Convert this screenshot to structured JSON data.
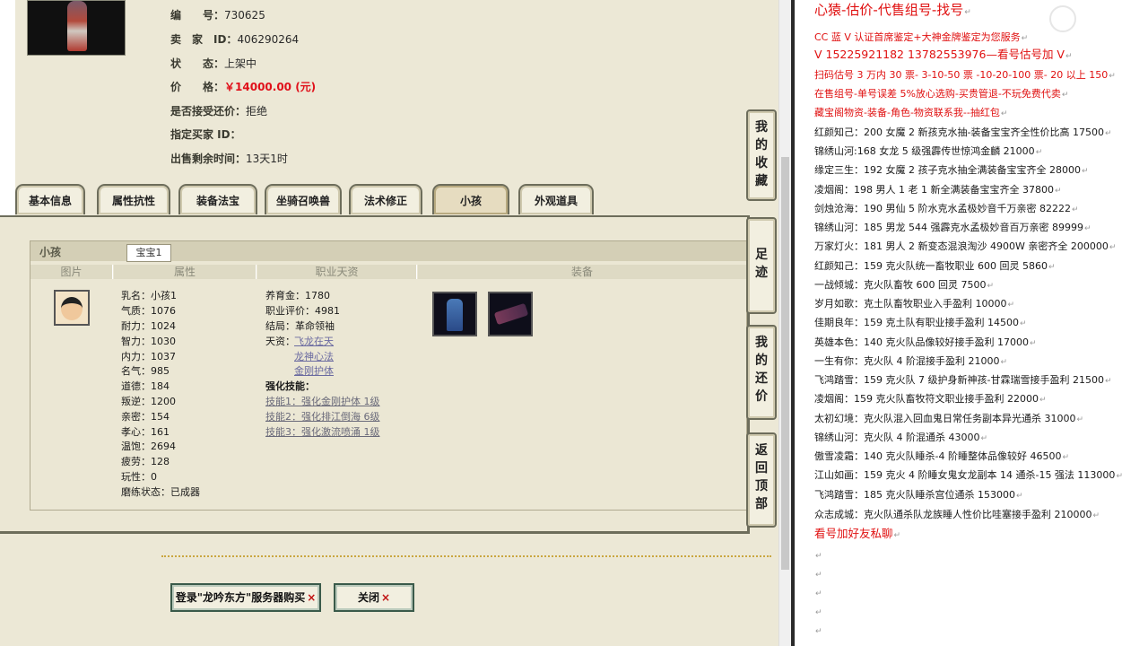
{
  "info": {
    "id_label": "编　　号：",
    "id_value": "730625",
    "seller_label": "卖　家　ID：",
    "seller_value": "406290264",
    "status_label": "状　　态：",
    "status_value": "上架中",
    "price_label": "价　　格：",
    "price_value": "￥14000.00 (元)",
    "bargain_label": "是否接受还价：",
    "bargain_value": "拒绝",
    "buyer_label": "指定买家 ID：",
    "buyer_value": "",
    "remaining_label": "出售剩余时间：",
    "remaining_value": "13天1时"
  },
  "tabs": [
    "基本信息",
    "属性抗性",
    "装备法宝",
    "坐骑召唤兽",
    "法术修正",
    "小孩",
    "外观道具"
  ],
  "child_panel": {
    "section_title": "小孩",
    "subtab": "宝宝1",
    "col_headers": [
      "图片",
      "属性",
      "职业天资",
      "装备"
    ],
    "stats": [
      "乳名：小孩1",
      "气质：1076",
      "耐力：1024",
      "智力：1030",
      "内力：1037",
      "名气：985",
      "道德：184",
      "叛逆：1200",
      "亲密：154",
      "孝心：161",
      "温饱：2694",
      "疲劳：128",
      "玩性：0",
      "磨练状态：已成器"
    ],
    "career": {
      "raise_gold": "养育金：1780",
      "eval": "职业评价：4981",
      "ending": "结局：革命领袖",
      "talent_label": "天资：",
      "talents": [
        "飞龙在天",
        "龙神心法",
        "金刚护体"
      ],
      "skills_label": "强化技能：",
      "skills": [
        "技能1：强化金刚护体 1级",
        "技能2：强化排江倒海 6级",
        "技能3：强化激流喷涌 1级"
      ]
    }
  },
  "side_buttons": [
    {
      "chars": [
        "我",
        "的",
        "收",
        "藏"
      ]
    },
    {
      "chars": [
        "足",
        "迹"
      ]
    },
    {
      "chars": [
        "我",
        "的",
        "还",
        "价"
      ]
    },
    {
      "chars": [
        "返",
        "回",
        "顶",
        "部"
      ]
    }
  ],
  "bottom_buttons": {
    "login": "登录\"龙吟东方\"服务器购买",
    "close": "关闭",
    "x": "×"
  },
  "doc": {
    "heading": "心猿-估价-代售组号-找号",
    "lines_red": [
      "CC 蓝 V 认证首席鉴定+大神金牌鉴定为您服务",
      "V 15225921182      13782553976—看号估号加 V",
      "扫码估号 3 万内 30 票- 3-10-50 票  -10-20-100 票- 20 以上 150",
      "在售组号-单号误差 5%放心选购-买贵管退-不玩免费代卖",
      "藏宝阁物资-装备-角色-物资联系我--抽红包"
    ],
    "listings": [
      "红颜知己：200 女魔 2 新孩克水抽-装备宝宝齐全性价比高 17500",
      "锦绣山河:168 女龙 5 级强霹传世惊鸿金麟 21000",
      "缘定三生：192 女魔 2 孩子克水抽全满装备宝宝齐全 28000",
      "凌烟阁：198 男人 1 老 1 新全满装备宝宝齐全 37800",
      "剑烛沧海：190 男仙 5 阶水克水孟极妙音千万亲密 82222",
      "锦绣山河：185 男龙 544 强霹克水孟极妙音百万亲密 89999",
      "万家灯火：181 男人 2 新变态混浪淘沙 4900W 亲密齐全 200000",
      "红颜知己：159 克火队统一畜牧职业 600 回灵 5860",
      "一战倾城：克火队畜牧 600 回灵 7500",
      "岁月如歌：克土队畜牧职业入手盈利 10000",
      "佳期良年：159 克土队有职业接手盈利 14500",
      "英雄本色：140 克火队品像较好接手盈利 17000",
      "一生有你：克火队 4 阶混接手盈利 21000",
      "飞鸿踏雪：159 克火队 7 级护身新神孩-甘霖瑞雪接手盈利 21500",
      "凌烟阁：159 克火队畜牧符文职业接手盈利 22000",
      "太初幻境：克火队混入回血鬼日常任务副本异光通杀 31000",
      "锦绣山河：克火队 4 阶混通杀 43000",
      "傲雪凌霜：140 克火队睡杀-4 阶睡整体品像较好 46500",
      "江山如画：159 克火 4 阶睡女鬼女龙副本 14 通杀-15 强法 113000",
      "飞鸿踏雪：185 克火队睡杀宫位通杀 153000",
      "众志成城：克火队通杀队龙族睡人性价比哇塞接手盈利 210000"
    ],
    "footer": "看号加好友私聊",
    "para_mark": "↵"
  }
}
